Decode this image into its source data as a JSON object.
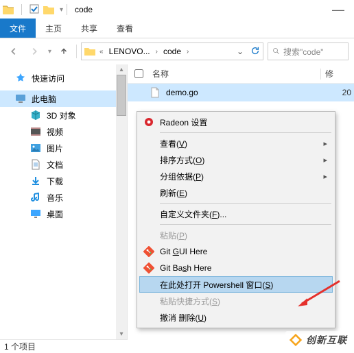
{
  "titlebar": {
    "title": "code",
    "minimize": "—"
  },
  "ribbon": {
    "file": "文件",
    "home": "主页",
    "share": "共享",
    "view": "查看"
  },
  "breadcrumb": {
    "overflow": "«",
    "seg1": "LENOVO...",
    "seg2": "code"
  },
  "search": {
    "placeholder": "搜索\"code\""
  },
  "sidebar": {
    "quick": "快速访问",
    "thispc": "此电脑",
    "children": {
      "objects3d": "3D 对象",
      "videos": "视频",
      "pictures": "图片",
      "documents": "文档",
      "downloads": "下载",
      "music": "音乐",
      "desktop": "桌面"
    }
  },
  "columns": {
    "name": "名称",
    "modified": "修"
  },
  "files": [
    {
      "name": "demo.go",
      "date_prefix": "20"
    }
  ],
  "statusbar": {
    "item_count": "1 个项目"
  },
  "context_menu": {
    "radeon": "Radeon 设置",
    "view": {
      "label": "查看",
      "key": "V"
    },
    "sort": {
      "label": "排序方式",
      "key": "O"
    },
    "group": {
      "label": "分组依据",
      "key": "P"
    },
    "refresh": {
      "label": "刷新",
      "key": "E"
    },
    "customize": {
      "label": "自定义文件夹",
      "key": "F"
    },
    "paste": {
      "label": "粘贴",
      "key": "P"
    },
    "git_gui": "Git GUI Here",
    "git_bash": "Git Bash Here",
    "powershell": {
      "label": "在此处打开 Powershell 窗口",
      "key": "S"
    },
    "paste_shortcut": {
      "label": "粘贴快捷方式",
      "key": "S"
    },
    "undo_delete": {
      "label": "撤消 删除",
      "key": "U"
    }
  },
  "watermark": {
    "text": "创新互联"
  }
}
